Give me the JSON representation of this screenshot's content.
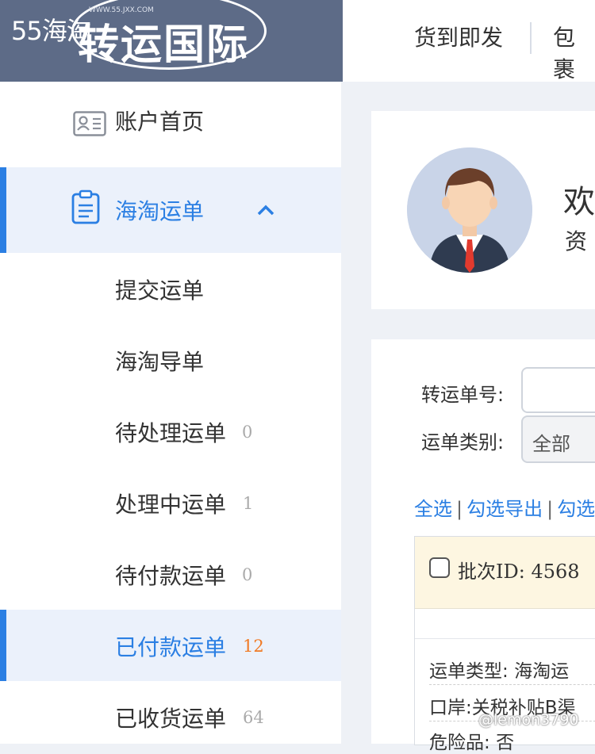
{
  "logo": {
    "site_tag": "55海淘",
    "name": "转运国际",
    "url": "WWW.55.JXX.COM"
  },
  "top_nav": {
    "items": [
      "货到即发",
      "包裹"
    ]
  },
  "sidebar": {
    "items": [
      {
        "label": "账户首页",
        "icon": "id-card-icon"
      },
      {
        "label": "海淘运单",
        "icon": "clipboard-icon",
        "expanded": true
      },
      {
        "label": "提交运单"
      },
      {
        "label": "海淘导单"
      },
      {
        "label": "待处理运单",
        "count": "0"
      },
      {
        "label": "处理中运单",
        "count": "1"
      },
      {
        "label": "待付款运单",
        "count": "0"
      },
      {
        "label": "已付款运单",
        "count": "12",
        "active": true
      },
      {
        "label": "已收货运单",
        "count": "64"
      }
    ]
  },
  "profile": {
    "welcome": "欢",
    "subtitle": "资"
  },
  "filters": {
    "transfer_no_label": "转运单号:",
    "transfer_no_value": "",
    "type_label": "运单类别:",
    "type_value": "全部"
  },
  "actions": {
    "select_all": "全选",
    "export_selected": "勾选导出",
    "more": "勾选"
  },
  "order": {
    "batch_label": "批次ID:",
    "batch_id": "4568",
    "type_label": "运单类型:",
    "type_value": "海淘运",
    "port_label": "口岸:",
    "port_value": "关税补贴B渠",
    "danger_label": "危险品:",
    "danger_value": "否"
  },
  "watermark": "@lemon3790",
  "colors": {
    "accent": "#2b7fe3",
    "count_highlight": "#f07a24",
    "header_bg": "#5d6b87"
  }
}
